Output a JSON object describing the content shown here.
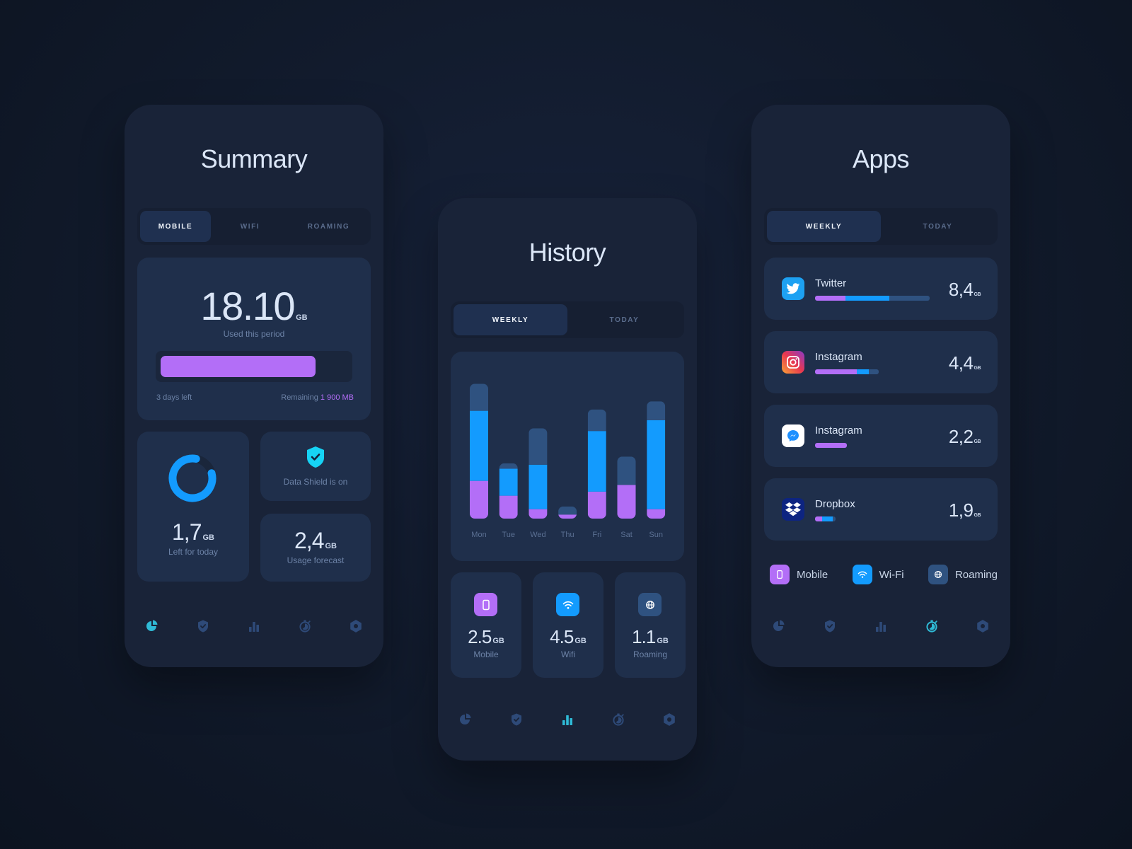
{
  "colors": {
    "purple": "#b36ef7",
    "blue": "#139bfe",
    "slate": "#2f5280",
    "teal": "#2fbad6",
    "tab_inactive": "#2e4a78"
  },
  "summary": {
    "title": "Summary",
    "tabs": [
      {
        "label": "MOBILE",
        "active": true
      },
      {
        "label": "WIFI",
        "active": false
      },
      {
        "label": "ROAMING",
        "active": false
      }
    ],
    "used": {
      "value": "18.10",
      "unit": "GB",
      "label": "Used this period"
    },
    "progress": {
      "fraction": 0.83,
      "days_left": "3 days left",
      "remaining_label": "Remaining",
      "remaining_value": "1 900 MB"
    },
    "today": {
      "value": "1,7",
      "unit": "GB",
      "label": "Left for today",
      "ring_fraction": 0.82
    },
    "shield": {
      "label": "Data Shield is on",
      "icon": "shield-check-icon"
    },
    "forecast": {
      "value": "2,4",
      "unit": "GB",
      "label": "Usage forecast"
    },
    "active_tab": "summary"
  },
  "history": {
    "title": "History",
    "tabs": [
      {
        "label": "WEEKLY",
        "active": true
      },
      {
        "label": "TODAY",
        "active": false
      }
    ],
    "stats": [
      {
        "value": "2.5",
        "unit": "GB",
        "label": "Mobile",
        "icon": "phone-icon",
        "color": "#b36ef7"
      },
      {
        "value": "4.5",
        "unit": "GB",
        "label": "Wifi",
        "icon": "wifi-icon",
        "color": "#139bfe"
      },
      {
        "value": "1.1",
        "unit": "GB",
        "label": "Roaming",
        "icon": "globe-icon",
        "color": "#2f5280"
      }
    ],
    "active_tab": "history"
  },
  "chart_data": {
    "type": "bar",
    "stacked": true,
    "title": "",
    "xlabel": "",
    "ylabel": "",
    "grid": false,
    "categories": [
      "Mon",
      "Tue",
      "Wed",
      "Thu",
      "Fri",
      "Sat",
      "Sun"
    ],
    "series": [
      {
        "name": "Mobile",
        "color": "#b36ef7",
        "values": [
          2.8,
          1.7,
          0.7,
          0.3,
          2.0,
          2.5,
          0.7
        ]
      },
      {
        "name": "Wifi",
        "color": "#139bfe",
        "values": [
          5.2,
          2.0,
          3.3,
          0.0,
          4.5,
          0.0,
          6.6
        ]
      },
      {
        "name": "Roaming",
        "color": "#2f5280",
        "values": [
          2.0,
          0.4,
          2.7,
          0.6,
          1.6,
          2.1,
          1.4
        ]
      }
    ],
    "ylim": [
      0,
      10.5
    ]
  },
  "apps": {
    "title": "Apps",
    "tabs": [
      {
        "label": "WEEKLY",
        "active": true
      },
      {
        "label": "TODAY",
        "active": false
      }
    ],
    "items": [
      {
        "name": "Twitter",
        "value": "8,4",
        "unit": "GB",
        "icon": "twitter-icon",
        "segments": [
          2.2,
          3.2,
          2.9
        ]
      },
      {
        "name": "Instagram",
        "value": "4,4",
        "unit": "GB",
        "icon": "instagram-icon",
        "segments": [
          3.0,
          0.9,
          0.7
        ]
      },
      {
        "name": "Instagram",
        "value": "2,2",
        "unit": "GB",
        "icon": "messenger-icon",
        "segments": [
          2.3,
          0,
          0
        ]
      },
      {
        "name": "Dropbox",
        "value": "1,9",
        "unit": "GB",
        "icon": "dropbox-icon",
        "segments": [
          0.5,
          0.8,
          0.2
        ]
      }
    ],
    "legend": [
      {
        "label": "Mobile",
        "icon": "phone-icon",
        "color": "#b36ef7"
      },
      {
        "label": "Wi-Fi",
        "icon": "wifi-icon",
        "color": "#139bfe"
      },
      {
        "label": "Roaming",
        "icon": "globe-icon",
        "color": "#2f5280"
      }
    ],
    "active_tab": "timer"
  },
  "tabbar": [
    "summary",
    "shield",
    "history",
    "timer",
    "settings"
  ]
}
